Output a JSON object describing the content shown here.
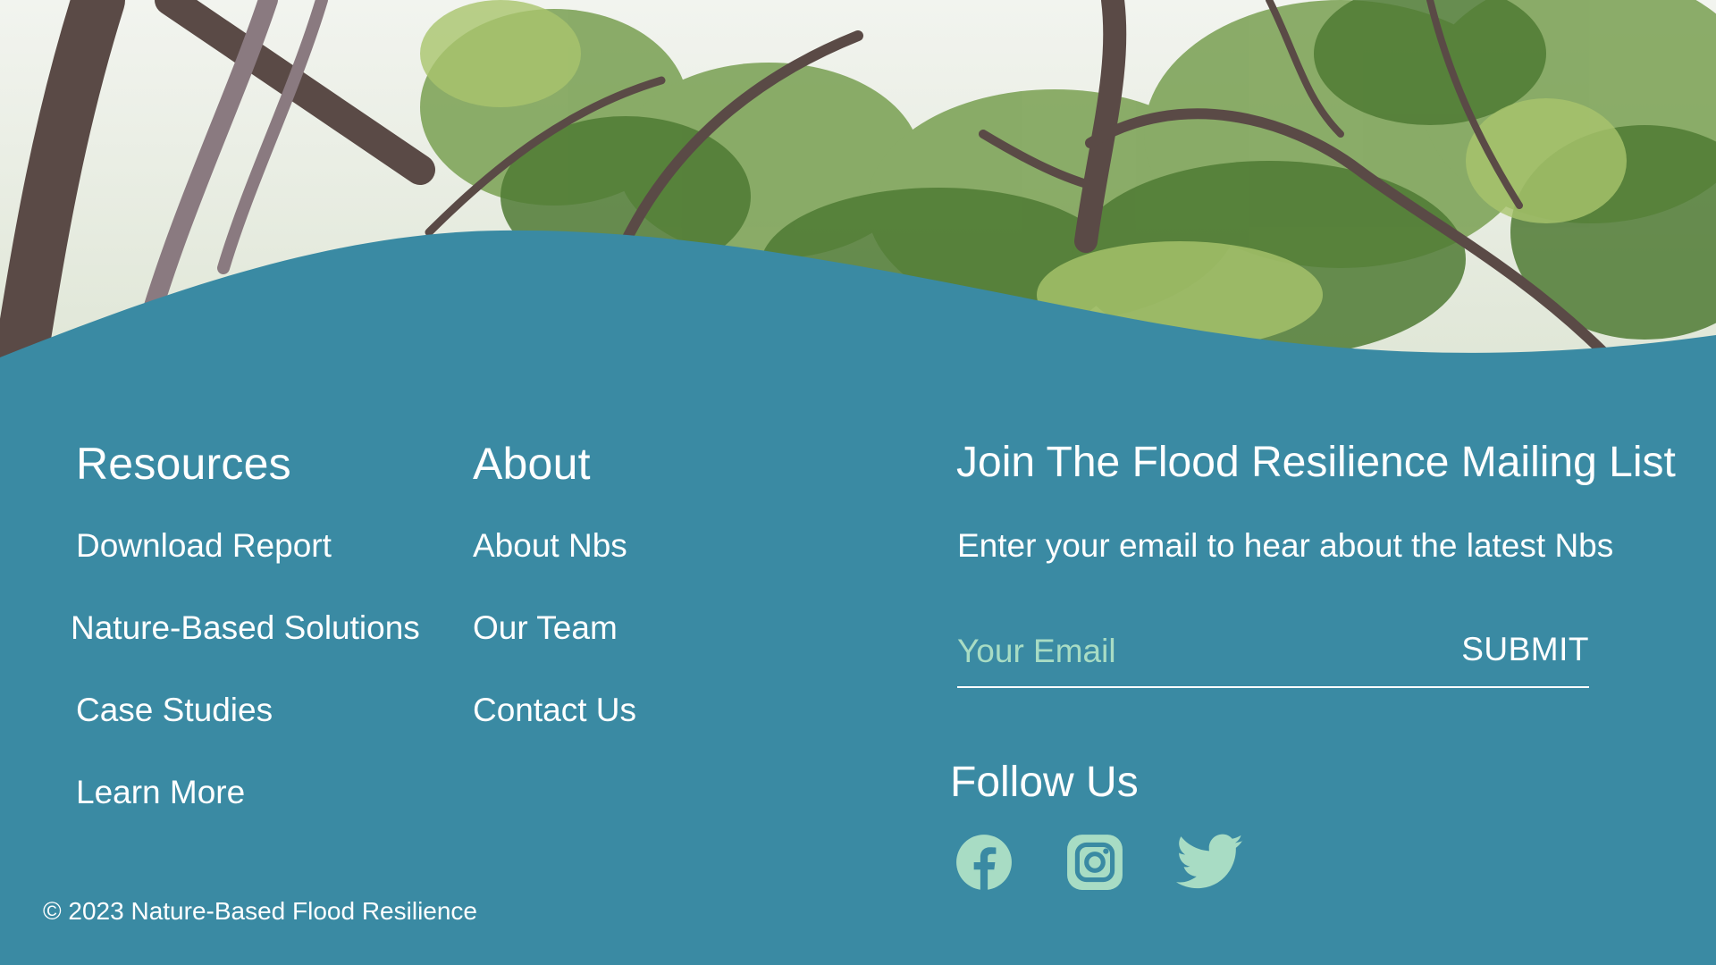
{
  "colors": {
    "footer_bg": "#3a8aa3",
    "social_icon": "#a8dcc4",
    "text": "#ffffff"
  },
  "hero": {
    "icon": "forest-photo"
  },
  "resources": {
    "title": "Resources",
    "links": [
      "Download Report",
      "Nature-Based Solutions",
      "Case Studies",
      "Learn More"
    ]
  },
  "about": {
    "title": "About",
    "links": [
      "About Nbs",
      "Our Team",
      "Contact Us"
    ]
  },
  "mailing": {
    "title": "Join The Flood Resilience Mailing List",
    "subtitle": "Enter your email to hear about the latest Nbs",
    "email_placeholder": "Your Email",
    "submit_label": "SUBMIT"
  },
  "follow": {
    "title": "Follow Us",
    "icons": [
      "facebook-icon",
      "instagram-icon",
      "twitter-icon"
    ]
  },
  "copyright": "© 2023 Nature-Based Flood Resilience"
}
